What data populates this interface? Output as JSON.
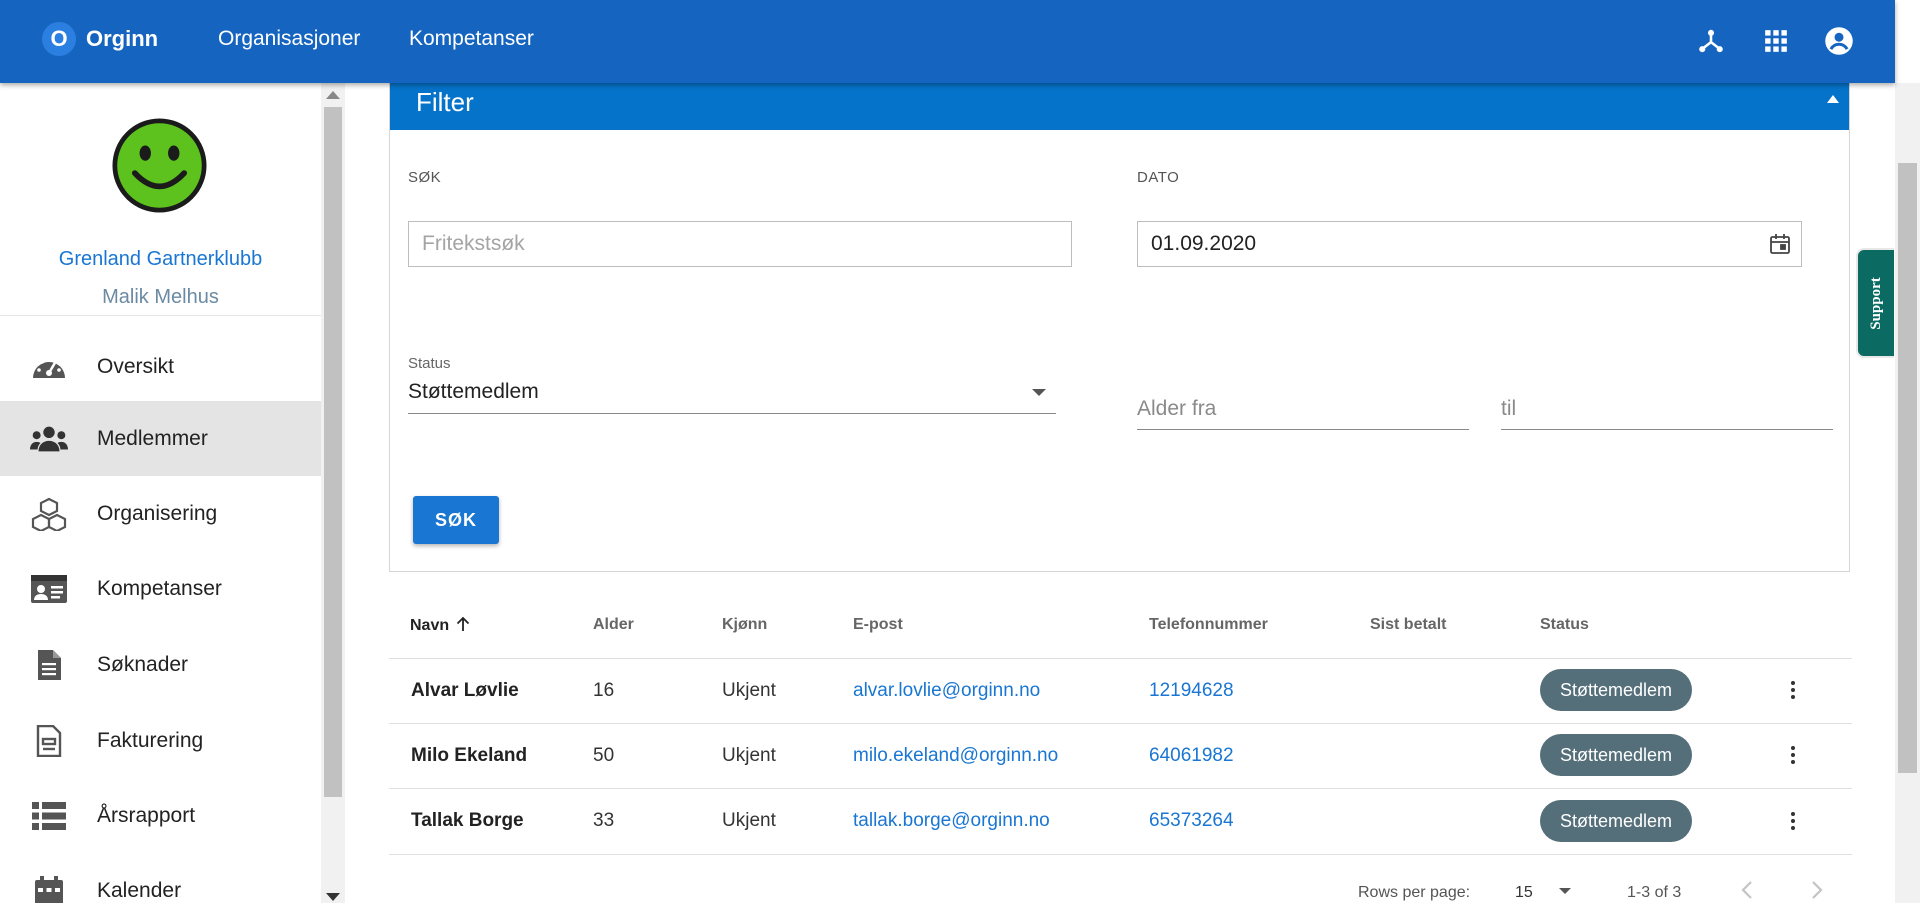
{
  "topbar": {
    "logo_letter": "O",
    "brand": "Orginn",
    "nav": [
      "Organisasjoner",
      "Kompetanser"
    ],
    "icons": [
      "network-icon",
      "apps-grid-icon",
      "account-circle-icon"
    ]
  },
  "sidebar": {
    "org_name": "Grenland Gartnerklubb",
    "user_name": "Malik Melhus",
    "items": [
      {
        "label": "Oversikt",
        "icon": "dashboard-gauge-icon"
      },
      {
        "label": "Medlemmer",
        "icon": "people-icon",
        "active": true
      },
      {
        "label": "Organisering",
        "icon": "cubes-icon"
      },
      {
        "label": "Kompetanser",
        "icon": "id-card-icon"
      },
      {
        "label": "Søknader",
        "icon": "document-icon"
      },
      {
        "label": "Fakturering",
        "icon": "invoice-icon"
      },
      {
        "label": "Årsrapport",
        "icon": "list-icon"
      },
      {
        "label": "Kalender",
        "icon": "calendar-icon"
      }
    ]
  },
  "filter": {
    "title": "Filter",
    "search_label": "SØK",
    "search_placeholder": "Fritekstsøk",
    "date_label": "DATO",
    "date_value": "01.09.2020",
    "status_label": "Status",
    "status_value": "Støttemedlem",
    "age_from_placeholder": "Alder fra",
    "age_to_placeholder": "til",
    "search_button": "SØK"
  },
  "table": {
    "columns": [
      "Navn",
      "Alder",
      "Kjønn",
      "E-post",
      "Telefonnummer",
      "Sist betalt",
      "Status"
    ],
    "rows": [
      {
        "name": "Alvar Løvlie",
        "age": "16",
        "gender": "Ukjent",
        "email": "alvar.lovlie@orginn.no",
        "phone": "12194628",
        "last_paid": "",
        "status": "Støttemedlem"
      },
      {
        "name": "Milo Ekeland",
        "age": "50",
        "gender": "Ukjent",
        "email": "milo.ekeland@orginn.no",
        "phone": "64061982",
        "last_paid": "",
        "status": "Støttemedlem"
      },
      {
        "name": "Tallak Borge",
        "age": "33",
        "gender": "Ukjent",
        "email": "tallak.borge@orginn.no",
        "phone": "65373264",
        "last_paid": "",
        "status": "Støttemedlem"
      }
    ]
  },
  "pagination": {
    "rows_per_page_label": "Rows per page:",
    "rows_per_page": "15",
    "range": "1-3 of 3"
  },
  "support": "Support",
  "colors": {
    "topbar": "#1565c0",
    "filter_header": "#0573c9",
    "link": "#1976d2",
    "chip": "#546e7a",
    "support_tab": "#0b6b63"
  }
}
